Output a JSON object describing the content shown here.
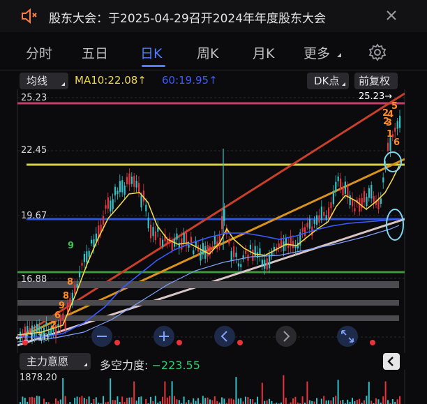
{
  "notice": {
    "icon": "speaker-icon",
    "text": "股东大会：于2025-04-29召开2024年年度股东大会",
    "close_icon": "close-icon"
  },
  "tabs": [
    {
      "label": "分时",
      "active": false
    },
    {
      "label": "五日",
      "active": false
    },
    {
      "label": "日K",
      "active": true
    },
    {
      "label": "周K",
      "active": false
    },
    {
      "label": "月K",
      "active": false
    },
    {
      "label": "更多",
      "active": false
    }
  ],
  "settings_icon": "gear-icon",
  "toolbar": {
    "indicator_select": "均线",
    "ma10": "MA10:22.08",
    "ma10_arrow": "↑",
    "ma60": "60:19.95",
    "ma60_arrow": "↑",
    "dk_select": "DK点",
    "adjust_button": "前复权"
  },
  "price_axis": {
    "labels": [
      "25.23",
      "22.45",
      "19.67",
      "16.88"
    ],
    "high_marker": "25.23→",
    "low_marker": "←11.10"
  },
  "signal_numbers": [
    "9",
    "8",
    "8",
    "9",
    "6",
    "2",
    "2",
    "5",
    "3",
    "4",
    "2",
    "1",
    "6"
  ],
  "controls": {
    "zoom_out_icon": "minus-icon",
    "zoom_in_icon": "plus-icon",
    "prev_icon": "chevron-left-icon",
    "next_icon": "chevron-right-icon",
    "fullscreen_icon": "expand-icon"
  },
  "sub_indicator": {
    "select": "主力意愿",
    "label": "多空力度:",
    "value": "−223.55",
    "collapse_icon": "chevron-left-icon"
  },
  "volume": {
    "max_label": "1878.20"
  },
  "colors": {
    "active_tab": "#4f7cff",
    "ma10": "#f0d84a",
    "ma60": "#3b5bff",
    "up": "#e8323c",
    "down": "#2fc3c7",
    "value_green": "#2ecc71"
  }
}
